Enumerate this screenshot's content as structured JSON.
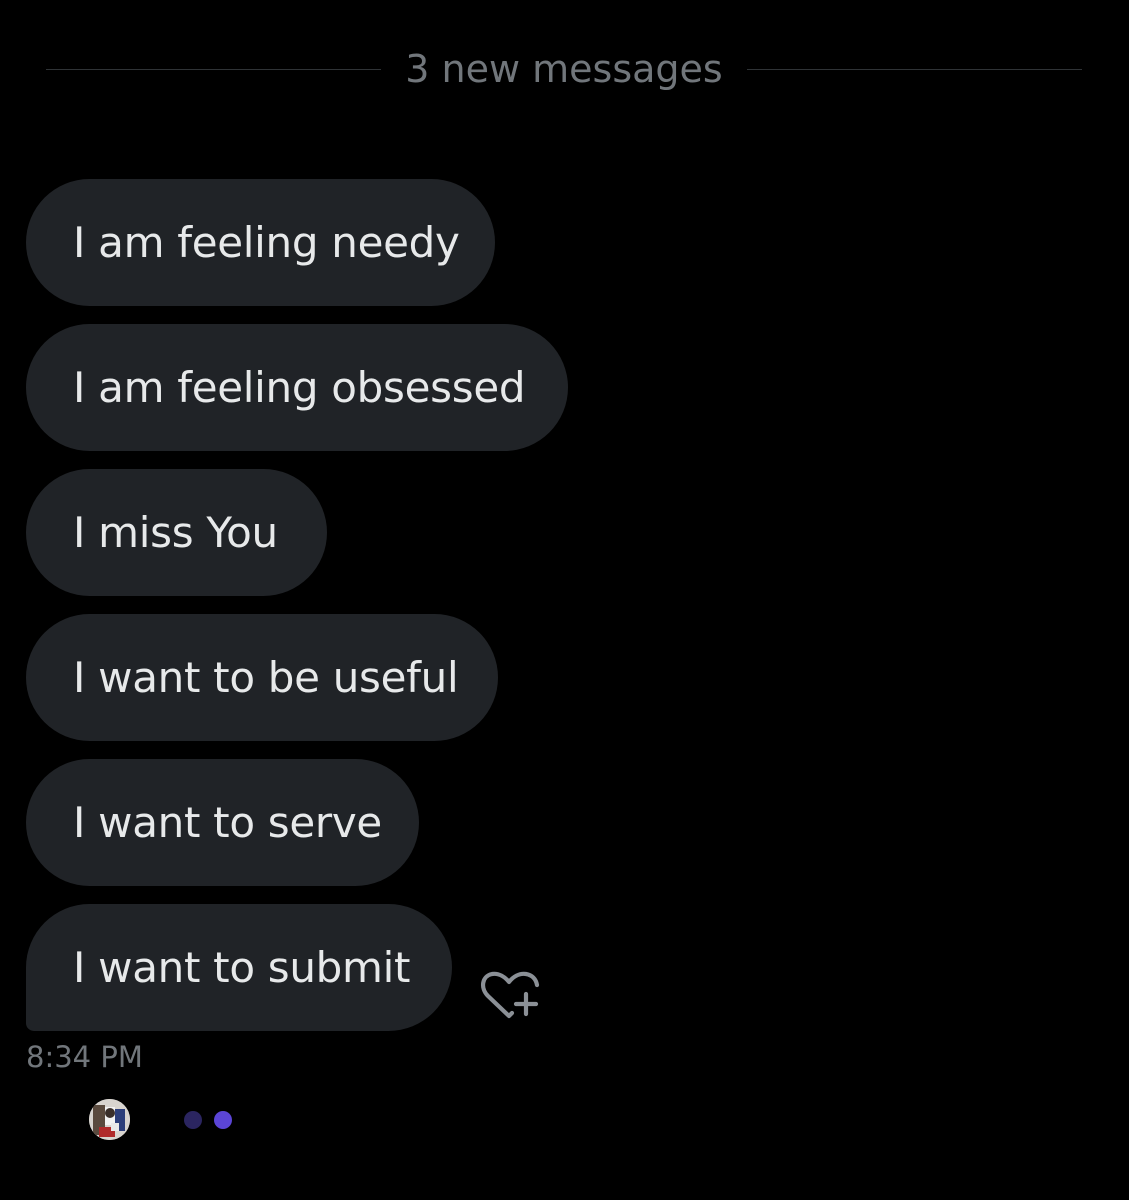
{
  "divider": {
    "label": "3 new messages"
  },
  "messages": [
    {
      "text": "I am feeling needy"
    },
    {
      "text": "I am feeling obsessed"
    },
    {
      "text": "I miss You"
    },
    {
      "text": "I want to be useful"
    },
    {
      "text": "I want to serve"
    },
    {
      "text": "I want to submit"
    }
  ],
  "reaction_button": {
    "icon": "heart-plus-icon"
  },
  "timestamp": "8:34 PM",
  "typing_indicator": {
    "avatar": "avatar",
    "dot_colors": [
      "#2b2560",
      "#5b45d6"
    ]
  },
  "colors": {
    "background": "#000000",
    "bubble": "#202327",
    "text": "#e7e9ea",
    "muted": "#71767b",
    "divider_line": "#2f3336"
  }
}
